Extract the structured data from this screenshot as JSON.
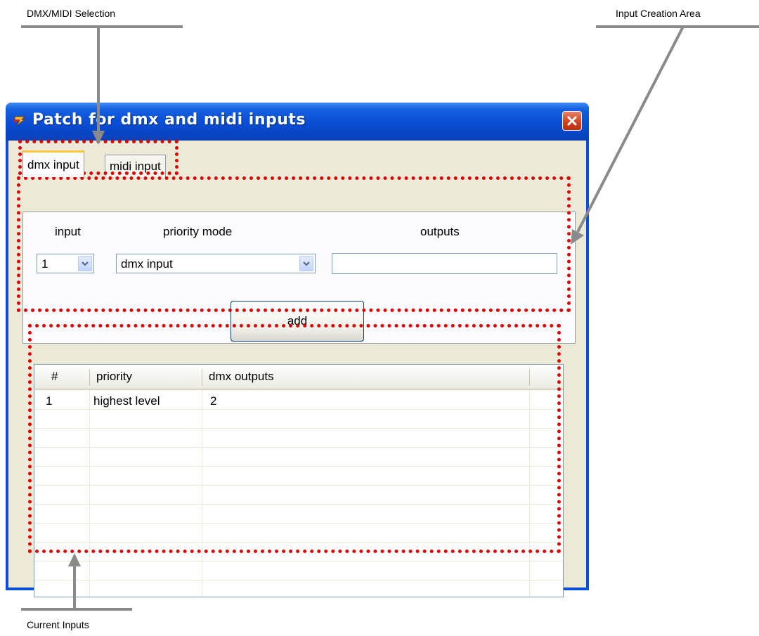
{
  "annotations": {
    "dmx_midi_selection": "DMX/MIDI Selection",
    "input_creation_area": "Input Creation Area",
    "current_inputs": "Current Inputs"
  },
  "window": {
    "title": "Patch for dmx and midi inputs",
    "close_icon": "close-icon"
  },
  "tabs": [
    {
      "label": "dmx input",
      "active": true
    },
    {
      "label": "midi input",
      "active": false
    }
  ],
  "form": {
    "input_label": "input",
    "priority_label": "priority mode",
    "outputs_label": "outputs",
    "input_value": "1",
    "priority_value": "dmx input",
    "outputs_value": "",
    "add_label": "add"
  },
  "list": {
    "columns": [
      "#",
      "priority",
      "dmx outputs"
    ],
    "rows": [
      {
        "num": "1",
        "priority": "highest level",
        "outputs": "2"
      }
    ]
  },
  "colors": {
    "titlebar": "#0a4ed6",
    "highlight": "#e00000",
    "callout": "#8a8a8a"
  }
}
